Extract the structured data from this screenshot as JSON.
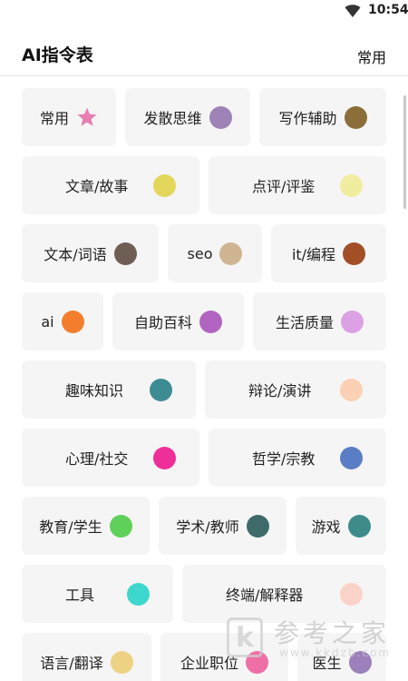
{
  "status_bar": {
    "time": "10:54",
    "wifi_icon": "wifi-icon"
  },
  "header": {
    "title": "AI指令表",
    "action": "常用"
  },
  "rows": [
    {
      "chips": [
        {
          "label": "常用",
          "icon": "star",
          "color": "#e77fb2",
          "w": 104
        },
        {
          "label": "发散思维",
          "color": "#9d83b5",
          "w": 138
        },
        {
          "label": "写作辅助",
          "color": "#8b6e3a",
          "w": 140
        }
      ]
    },
    {
      "chips": [
        {
          "label": "文章/故事",
          "color": "#e2d75a",
          "w": 196,
          "spread": true
        },
        {
          "label": "点评/评鉴",
          "color": "#f1eda0",
          "w": 196,
          "spread": true
        }
      ]
    },
    {
      "chips": [
        {
          "label": "文本/词语",
          "color": "#6f5e54",
          "w": 151
        },
        {
          "label": "seo",
          "color": "#cfb592",
          "w": 104
        },
        {
          "label": "it/编程",
          "color": "#a24e27",
          "w": 127
        }
      ]
    },
    {
      "chips": [
        {
          "label": "ai",
          "color": "#f47e2d",
          "w": 90
        },
        {
          "label": "自助百科",
          "color": "#b265c0",
          "w": 145
        },
        {
          "label": "生活质量",
          "color": "#dca1e4",
          "w": 147
        }
      ]
    },
    {
      "chips": [
        {
          "label": "趣味知识",
          "color": "#3d8c94",
          "w": 192,
          "spread": true
        },
        {
          "label": "辩论/演讲",
          "color": "#fbd0b4",
          "w": 200,
          "spread": true
        }
      ]
    },
    {
      "chips": [
        {
          "label": "心理/社交",
          "color": "#ee2f99",
          "w": 196,
          "spread": true
        },
        {
          "label": "哲学/宗教",
          "color": "#5a7ec5",
          "w": 196,
          "spread": true
        }
      ]
    },
    {
      "chips": [
        {
          "label": "教育/学生",
          "color": "#5fd15a",
          "w": 141
        },
        {
          "label": "学术/教师",
          "color": "#3e6b6a",
          "w": 141
        },
        {
          "label": "游戏",
          "color": "#3d8c8a",
          "w": 100
        }
      ]
    },
    {
      "chips": [
        {
          "label": "工具",
          "color": "#3ed7cd",
          "w": 167,
          "spread": true
        },
        {
          "label": "终端/解释器",
          "color": "#fad3c8",
          "w": 225,
          "spread": true
        }
      ]
    },
    {
      "chips": [
        {
          "label": "语言/翻译",
          "color": "#eed283",
          "w": 143
        },
        {
          "label": "企业职位",
          "color": "#ee6fa6",
          "w": 141
        },
        {
          "label": "医生",
          "color": "#9b80bc",
          "w": 98
        }
      ]
    }
  ],
  "watermark": {
    "mark": "k",
    "text": "参考之家",
    "url": "www.kkdzb.com"
  }
}
